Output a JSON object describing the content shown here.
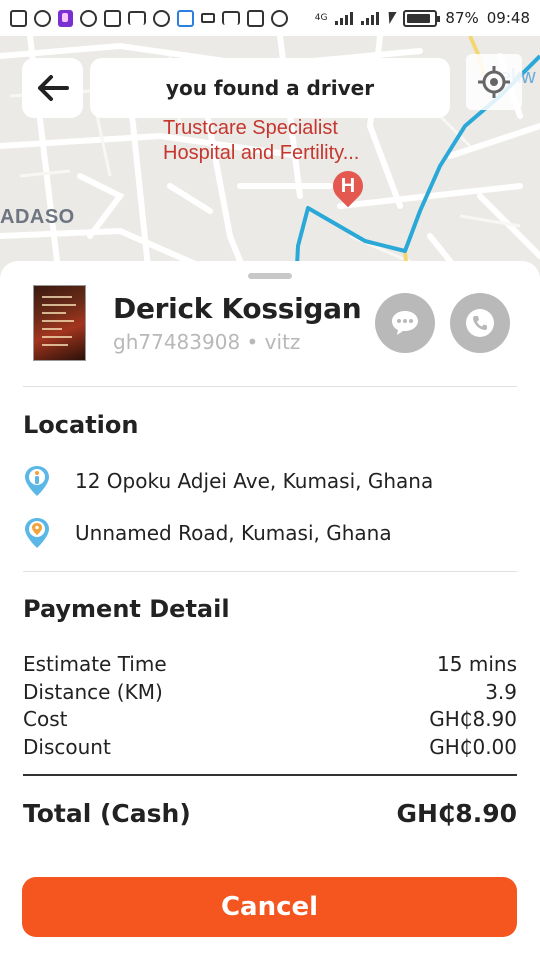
{
  "status_bar": {
    "network": "4G",
    "battery_percent": "87%",
    "battery_level": 0.87,
    "time": "09:48",
    "notification_icons": [
      "add-icon",
      "swirl-icon",
      "p-app-icon",
      "bitcoin-icon",
      "tshirt-icon",
      "gmail-icon",
      "chrome-icon",
      "browser-icon",
      "message-icon",
      "gmail-icon",
      "gallery-icon",
      "location-icon"
    ]
  },
  "map": {
    "poi_name": "Trustcare Specialist\nHospital and Fertility...",
    "poi_pin_letter": "H",
    "area_label": "ADASO",
    "corner_fragment": "ekw",
    "route_color": "#2aa8d8"
  },
  "header": {
    "back_icon": "arrow-left-icon",
    "title": "you found a driver",
    "locate_icon": "gps-target-icon"
  },
  "driver": {
    "name": "Derick Kossigan",
    "plate_and_car": "gh77483908 • vitz",
    "message_icon": "chat-bubble-icon",
    "call_icon": "phone-icon"
  },
  "location": {
    "title": "Location",
    "pickup": "12 Opoku Adjei Ave, Kumasi, Ghana",
    "dropoff": "Unnamed Road, Kumasi, Ghana",
    "pickup_icon": "person-pin-icon",
    "dropoff_icon": "location-pin-icon"
  },
  "payment": {
    "title": "Payment Detail",
    "rows": [
      {
        "label": "Estimate Time",
        "value": "15 mins"
      },
      {
        "label": "Distance (KM)",
        "value": "3.9"
      },
      {
        "label": "Cost",
        "value": "GH₵8.90"
      },
      {
        "label": "Discount",
        "value": "GH₵0.00"
      }
    ],
    "total_label": "Total (Cash)",
    "total_value": "GH₵8.90"
  },
  "actions": {
    "cancel_label": "Cancel"
  },
  "colors": {
    "accent": "#f5551f",
    "icon_blue": "#5bb8e6",
    "icon_orange": "#f3a23a",
    "poi_red": "#c5362e"
  }
}
